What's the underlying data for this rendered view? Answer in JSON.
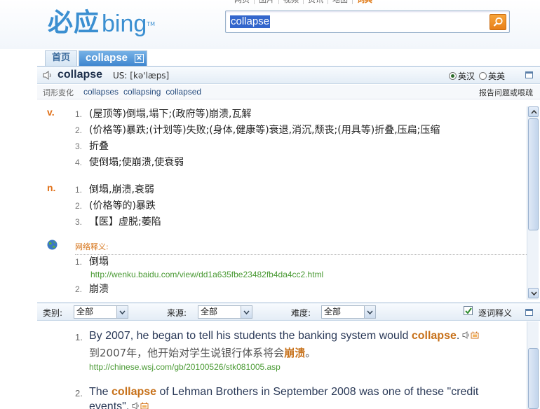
{
  "header": {
    "logo_cn": "必应",
    "logo_en": "bing",
    "logo_tm": "TM",
    "nav": [
      "网页",
      "图片",
      "视频",
      "资讯",
      "地图",
      "词典"
    ],
    "search_value": "collapse"
  },
  "tabs": {
    "home": "首页",
    "current": "collapse",
    "close": "✕"
  },
  "word": {
    "headword": "collapse",
    "phonetic": "US: [kə'læps]",
    "radio_en_cn": "英汉",
    "radio_en_en": "英英",
    "inflection_label": "词形变化",
    "inflections": [
      "collapses",
      "collapsing",
      "collapsed"
    ],
    "report": "报告问题或哏疏"
  },
  "definitions": {
    "verb": {
      "pos": "v.",
      "items": [
        {
          "n": "1.",
          "text": "(屋顶等)倒塌,塌下;(政府等)崩溃,瓦解"
        },
        {
          "n": "2.",
          "text": "(价格等)暴跌;(计划等)失败;(身体,健康等)衰退,消沉,颓丧;(用具等)折叠,压扁;压缩"
        },
        {
          "n": "3.",
          "text": "折叠"
        },
        {
          "n": "4.",
          "text": "使倒塌;使崩溃,使衰弱"
        }
      ]
    },
    "noun": {
      "pos": "n.",
      "items": [
        {
          "n": "1.",
          "text": "倒塌,崩溃,衰弱"
        },
        {
          "n": "2.",
          "text": "(价格等的)暴跌"
        },
        {
          "n": "3.",
          "text": "【医】虚脱;萎陷"
        }
      ]
    },
    "web": {
      "title": "网络释义:",
      "items": [
        {
          "n": "1.",
          "text": "倒塌",
          "url": "http://wenku.baidu.com/view/dd1a635fbe23482fb4da4cc2.html"
        },
        {
          "n": "2.",
          "text": "崩溃",
          "url": ""
        }
      ]
    }
  },
  "filter": {
    "category_label": "类别:",
    "category_value": "全部",
    "source_label": "来源:",
    "source_value": "全部",
    "difficulty_label": "难度:",
    "difficulty_value": "全部",
    "word_by_word": "逐词释义"
  },
  "examples": [
    {
      "n": "1.",
      "en_before": "By 2007, he began to tell his students the banking system would ",
      "en_hl": "collapse",
      "en_after": ".",
      "cn_before": "到2007年，他开始对学生说银行体系将会",
      "cn_hl": "崩溃",
      "cn_after": "。",
      "url": "http://chinese.wsj.com/gb/20100526/stk081005.asp"
    },
    {
      "n": "2.",
      "en_before": "The ",
      "en_hl": "collapse",
      "en_after": " of Lehman Brothers in September 2008 was one of these \"credit",
      "en_line2": "events\"."
    }
  ],
  "colors": {
    "accent_blue": "#3b8fd1",
    "highlight_orange": "#c7711a",
    "url_green": "#4a9a34"
  }
}
